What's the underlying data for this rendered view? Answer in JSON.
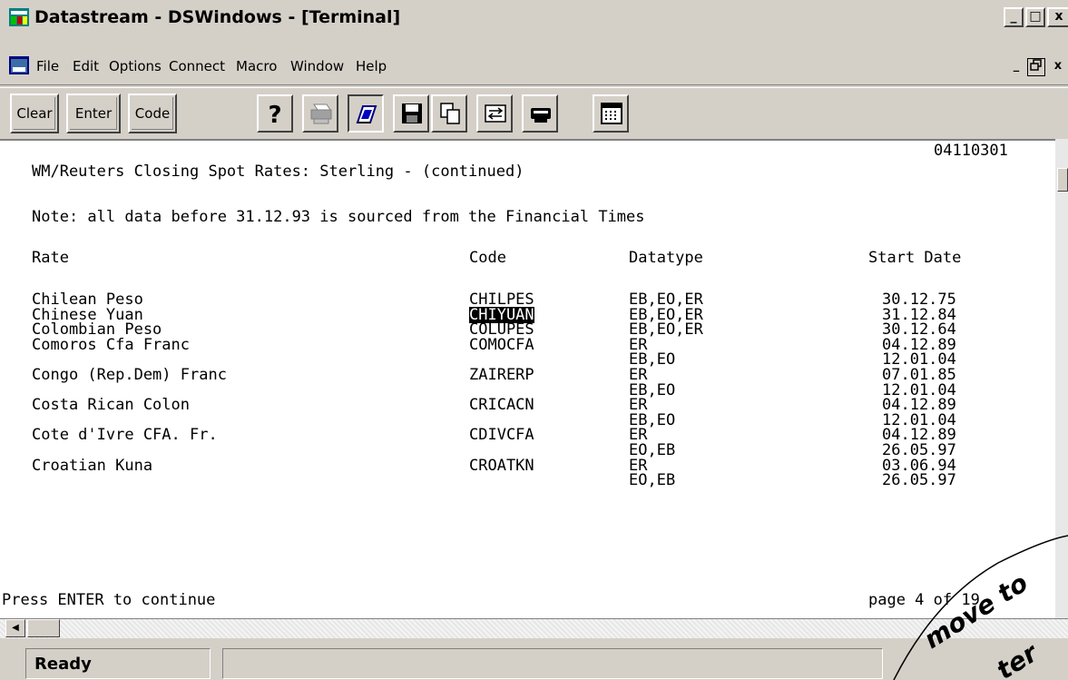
{
  "window": {
    "title": "Datastream - DSWindows - [Terminal]",
    "controls": {
      "minimize": "_",
      "maximize": "□",
      "close": "x"
    },
    "mdi_controls": {
      "minimize": "_",
      "restore": "🗗",
      "close": "x"
    }
  },
  "menu": {
    "items": [
      "File",
      "Edit",
      "Options",
      "Connect",
      "Macro",
      "Window",
      "Help"
    ]
  },
  "toolbar": {
    "clear_label": "Clear",
    "enter_label": "Enter",
    "code_label": "Code",
    "icons": [
      "help-icon",
      "print-icon",
      "connect-icon",
      "save-icon",
      "copy-icon",
      "transfer-icon",
      "printer-queue-icon",
      "grid-icon"
    ]
  },
  "terminal": {
    "page_id": "04110301",
    "heading": "WM/Reuters Closing Spot Rates: Sterling - (continued)",
    "note": "Note: all data before 31.12.93 is sourced from the Financial Times",
    "columns": [
      "Rate",
      "Code",
      "Datatype",
      "Start Date"
    ],
    "rows": [
      {
        "rate": "Chilean Peso",
        "code": "CHILPES",
        "datatype": "EB,EO,ER",
        "start": "30.12.75"
      },
      {
        "rate": "Chinese Yuan",
        "code": "CHIYUAN",
        "datatype": "EB,EO,ER",
        "start": "31.12.84"
      },
      {
        "rate": "Colombian Peso",
        "code": "COLUPES",
        "datatype": "EB,EO,ER",
        "start": "30.12.64"
      },
      {
        "rate": "Comoros Cfa Franc",
        "code": "COMOCFA",
        "datatype": "ER",
        "start": "04.12.89"
      },
      {
        "rate": "",
        "code": "",
        "datatype": "EB,EO",
        "start": "12.01.04"
      },
      {
        "rate": "Congo (Rep.Dem) Franc",
        "code": "ZAIRERP",
        "datatype": "ER",
        "start": "07.01.85"
      },
      {
        "rate": "",
        "code": "",
        "datatype": "EB,EO",
        "start": "12.01.04"
      },
      {
        "rate": "Costa Rican Colon",
        "code": "CRICACN",
        "datatype": "ER",
        "start": "04.12.89"
      },
      {
        "rate": "",
        "code": "",
        "datatype": "EB,EO",
        "start": "12.01.04"
      },
      {
        "rate": "Cote d'Ivre CFA. Fr.",
        "code": "CDIVCFA",
        "datatype": "ER",
        "start": "04.12.89"
      },
      {
        "rate": "",
        "code": "",
        "datatype": "EO,EB",
        "start": "26.05.97"
      },
      {
        "rate": "Croatian Kuna",
        "code": "CROATKN",
        "datatype": "ER",
        "start": "03.06.94"
      },
      {
        "rate": "",
        "code": "",
        "datatype": "EO,EB",
        "start": "26.05.97"
      }
    ],
    "footer_left": "Press ENTER to continue",
    "footer_right": "page 4 of 19"
  },
  "status": {
    "text": "Ready"
  },
  "annotation": {
    "text1": "move to",
    "text2": "ter"
  }
}
